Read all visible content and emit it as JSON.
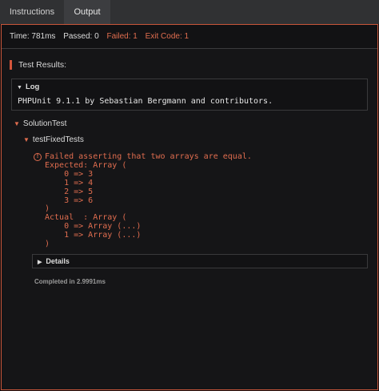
{
  "tabs": {
    "instructions": "Instructions",
    "output": "Output"
  },
  "status": {
    "time": "Time: 781ms",
    "passed": "Passed: 0",
    "failed": "Failed: 1",
    "exit_code": "Exit Code: 1"
  },
  "results": {
    "header": "Test Results:"
  },
  "log": {
    "title": "Log",
    "line": "PHPUnit 9.1.1 by Sebastian Bergmann and contributors."
  },
  "suite": {
    "name": "SolutionTest"
  },
  "testcase": {
    "name": "testFixedTests"
  },
  "failure": {
    "message": "Failed asserting that two arrays are equal.",
    "body": "Expected: Array (\n    0 => 3\n    1 => 4\n    2 => 5\n    3 => 6\n)\nActual  : Array (\n    0 => Array (...)\n    1 => Array (...)\n)"
  },
  "details": {
    "label": "Details"
  },
  "completed": "Completed in 2.9991ms",
  "colors": {
    "accent": "#e06d4f",
    "border": "#c9563a",
    "background": "#151517"
  },
  "icons": {
    "error": "error-circle-icon",
    "expand": "triangle-down-icon",
    "collapsed": "triangle-right-icon"
  }
}
